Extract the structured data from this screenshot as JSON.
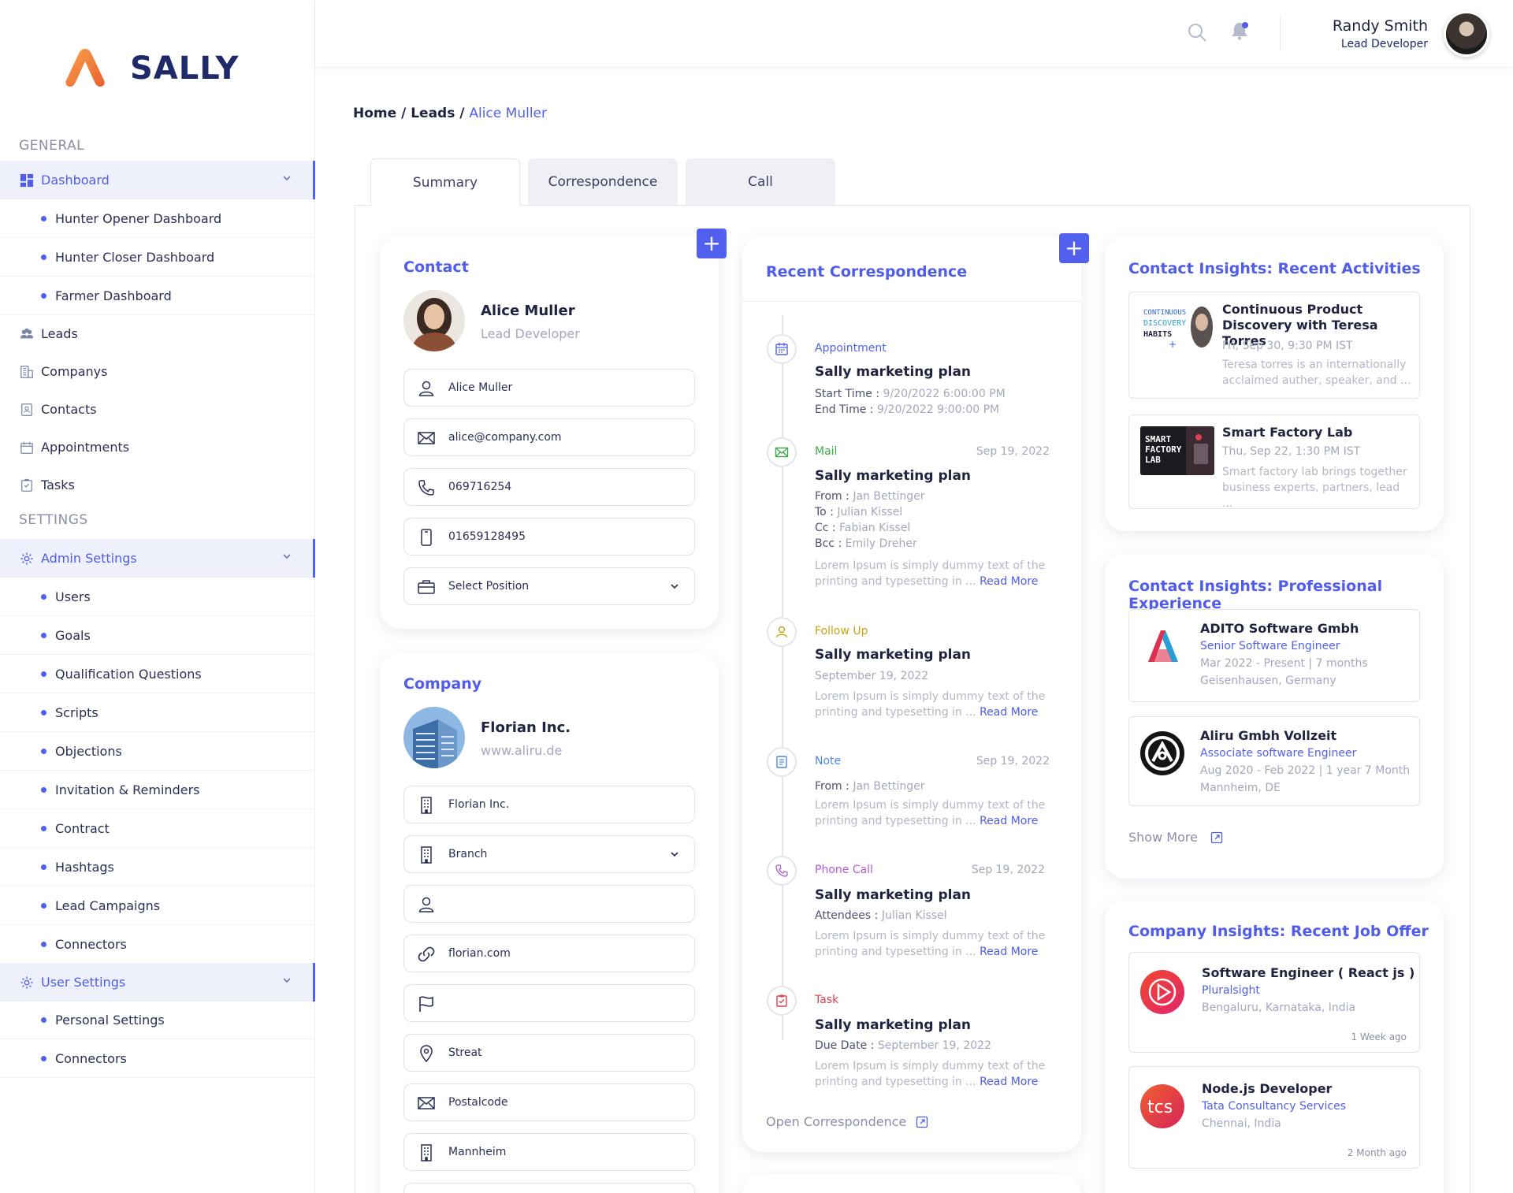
{
  "app": {
    "name": "SALLY"
  },
  "sidebar": {
    "general_title": "GENERAL",
    "settings_title": "SETTINGS",
    "dashboard": {
      "label": "Dashboard",
      "sub": [
        "Hunter Opener Dashboard",
        "Hunter Closer Dashboard",
        "Farmer Dashboard"
      ]
    },
    "items": [
      "Leads",
      "Companys",
      "Contacts",
      "Appointments",
      "Tasks"
    ],
    "admin_settings": {
      "label": "Admin Settings",
      "sub": [
        "Users",
        "Goals",
        "Qualification Questions",
        "Scripts",
        "Objections",
        "Invitation & Reminders",
        "Contract",
        "Hashtags",
        "Lead Campaigns",
        "Connectors"
      ]
    },
    "user_settings": {
      "label": "User Settings",
      "sub": [
        "Personal Settings",
        "Connectors"
      ]
    }
  },
  "header": {
    "user_name": "Randy Smith",
    "user_role": "Lead Developer"
  },
  "breadcrumb": {
    "home": "Home",
    "sep": " / ",
    "leads": "Leads",
    "current": "Alice Muller"
  },
  "tabs": [
    "Summary",
    "Correspondence",
    "Call"
  ],
  "contact": {
    "title": "Contact",
    "name": "Alice Muller",
    "role": "Lead Developer",
    "fields": {
      "name": "Alice Muller",
      "email": "alice@company.com",
      "phone": "069716254",
      "mobile": "01659128495",
      "position": "Select Position"
    }
  },
  "company": {
    "title": "Company",
    "name": "Florian Inc.",
    "website": "www.aliru.de",
    "fields": {
      "company": "Florian Inc.",
      "branch": "Branch",
      "person": "",
      "link": "florian.com",
      "flag": "",
      "street": "Streat",
      "postal": "Postalcode",
      "city": "Mannheim"
    }
  },
  "correspondence": {
    "title": "Recent Correspondence",
    "items": [
      {
        "type": "Appointment",
        "date": "",
        "title": "Sally marketing plan",
        "meta": [
          [
            "Start Time :",
            "9/20/2022 6:00:00 PM"
          ],
          [
            "End Time :",
            "9/20/2022 9:00:00 PM"
          ]
        ],
        "desc": "",
        "read_more": ""
      },
      {
        "type": "Mail",
        "date": "Sep 19, 2022",
        "title": "Sally marketing plan",
        "meta": [
          [
            "From :",
            "Jan Bettinger"
          ],
          [
            "To :",
            "Julian Kissel"
          ],
          [
            "Cc :",
            "Fabian Kissel"
          ],
          [
            "Bcc :",
            "Emily Dreher"
          ]
        ],
        "desc": "Lorem Ipsum is simply dummy text of the printing and typesetting in ...",
        "read_more": "Read More"
      },
      {
        "type": "Follow Up",
        "date": "",
        "title": "Sally marketing plan",
        "meta": [
          [
            "",
            "September 19, 2022"
          ]
        ],
        "desc": "Lorem Ipsum is simply dummy text of the printing and typesetting in ...",
        "read_more": "Read More"
      },
      {
        "type": "Note",
        "date": "Sep 19, 2022",
        "title": "",
        "meta": [
          [
            "From :",
            "Jan Bettinger"
          ]
        ],
        "desc": "Lorem Ipsum is simply dummy text of the printing and typesetting in ...",
        "read_more": "Read More"
      },
      {
        "type": "Phone Call",
        "date": "Sep 19, 2022",
        "title": "Sally marketing plan",
        "meta": [
          [
            "Attendees :",
            "Julian Kissel"
          ]
        ],
        "desc": "Lorem Ipsum is simply dummy text of the printing and typesetting in ...",
        "read_more": "Read More"
      },
      {
        "type": "Task",
        "date": "",
        "title": "Sally marketing plan",
        "meta": [
          [
            "Due Date :",
            "September 19, 2022"
          ]
        ],
        "desc": "Lorem Ipsum is simply dummy text of the printing and typesetting in ...",
        "read_more": "Read More"
      }
    ],
    "open_label": "Open Correspondence"
  },
  "activities": {
    "title": "Contact Insights: Recent Activities",
    "items": [
      {
        "title": "Continuous Product Discovery with Teresa Torres",
        "date": "Fri, Sep 30, 9:30 PM IST",
        "desc": "Teresa torres is an internationally acclaimed auther, speaker, and ...",
        "thumb_text": "CONTINUOUS DISCOVERY HABITS"
      },
      {
        "title": "Smart Factory Lab",
        "date": "Thu, Sep 22, 1:30 PM IST",
        "desc": "Smart factory lab brings together business experts, partners, lead ...",
        "thumb_text": "SMART FACTORY LAB"
      }
    ]
  },
  "experience": {
    "title": "Contact Insights: Professional Experience",
    "items": [
      {
        "company": "ADITO Software Gmbh",
        "role": "Senior Software Engineer",
        "period": "Mar 2022 - Present | 7 months",
        "location": "Geisenhausen, Germany"
      },
      {
        "company": "Aliru Gmbh Vollzeit",
        "role": "Associate software Engineer",
        "period": "Aug 2020 - Feb 2022 | 1 year 7 Month",
        "location": "Mannheim, DE"
      }
    ],
    "show_more": "Show More"
  },
  "jobs": {
    "title": "Company Insights: Recent Job Offer",
    "items": [
      {
        "title": "Software Engineer ( React js )",
        "company": "Pluralsight",
        "location": "Bengaluru, Karnataka, India",
        "ago": "1 Week ago"
      },
      {
        "title": "Node.js Developer",
        "company": "Tata Consultancy Services",
        "location": "Chennai, India",
        "ago": "2 Month ago"
      }
    ]
  },
  "colors": {
    "accent": "#5161ee",
    "appointment": "#5161ee",
    "mail": "#3aa94a",
    "follow_up": "#c9a30c",
    "note": "#4f86ee",
    "phone_call": "#b25ad9",
    "task": "#e0404f"
  }
}
